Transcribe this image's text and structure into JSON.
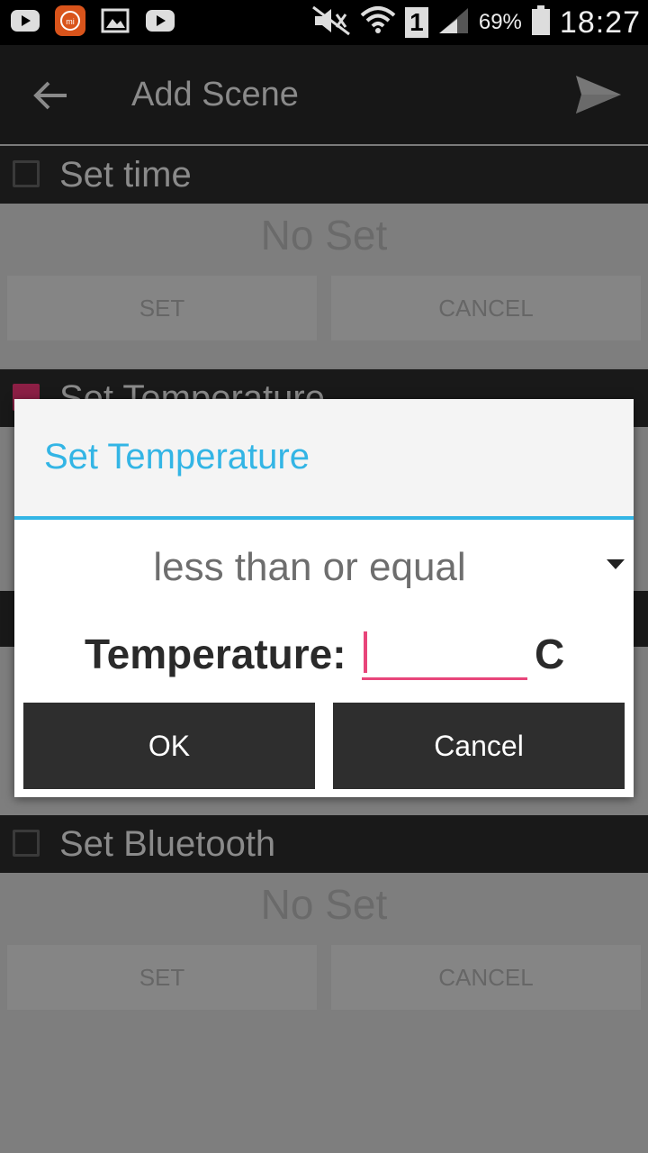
{
  "status_bar": {
    "battery_percent": "69%",
    "time": "18:27",
    "sim_slot": "1",
    "icons": [
      "youtube-icon",
      "mi-icon",
      "gallery-icon",
      "youtube-icon",
      "mute-icon",
      "wifi-icon",
      "sim-icon",
      "signal-icon",
      "battery-icon"
    ]
  },
  "app_bar": {
    "title": "Add Scene",
    "icons": [
      "back-arrow-icon",
      "send-icon"
    ]
  },
  "sections": {
    "time": {
      "label": "Set time",
      "checked": false,
      "value": "No Set",
      "set_label": "SET",
      "cancel_label": "CANCEL"
    },
    "temperature": {
      "label": "Set Temperature",
      "checked": true
    },
    "bluetooth": {
      "label": "Set Bluetooth",
      "checked": false,
      "value": "No Set",
      "set_label": "SET",
      "cancel_label": "CANCEL"
    }
  },
  "dialog": {
    "title": "Set Temperature",
    "comparison": "less than or equal",
    "temperature_label": "Temperature:",
    "temperature_value": "",
    "unit": "C",
    "ok_label": "OK",
    "cancel_label": "Cancel",
    "accent_color": "#33b5e5",
    "input_color": "#e8457a"
  }
}
